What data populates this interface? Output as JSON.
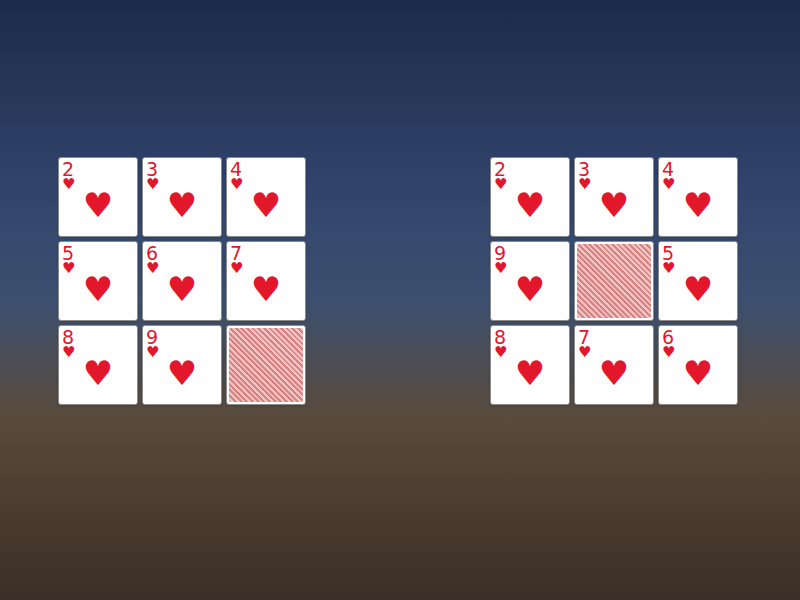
{
  "target": {
    "cards": [
      {
        "kind": "face",
        "rank": "2",
        "suit": "♥"
      },
      {
        "kind": "face",
        "rank": "3",
        "suit": "♥"
      },
      {
        "kind": "face",
        "rank": "4",
        "suit": "♥"
      },
      {
        "kind": "face",
        "rank": "5",
        "suit": "♥"
      },
      {
        "kind": "face",
        "rank": "6",
        "suit": "♥"
      },
      {
        "kind": "face",
        "rank": "7",
        "suit": "♥"
      },
      {
        "kind": "face",
        "rank": "8",
        "suit": "♥"
      },
      {
        "kind": "face",
        "rank": "9",
        "suit": "♥"
      },
      {
        "kind": "back"
      }
    ]
  },
  "board": {
    "cards": [
      {
        "kind": "face",
        "rank": "2",
        "suit": "♥"
      },
      {
        "kind": "face",
        "rank": "3",
        "suit": "♥"
      },
      {
        "kind": "face",
        "rank": "4",
        "suit": "♥"
      },
      {
        "kind": "face",
        "rank": "9",
        "suit": "♥"
      },
      {
        "kind": "back"
      },
      {
        "kind": "face",
        "rank": "5",
        "suit": "♥"
      },
      {
        "kind": "face",
        "rank": "8",
        "suit": "♥"
      },
      {
        "kind": "face",
        "rank": "7",
        "suit": "♥"
      },
      {
        "kind": "face",
        "rank": "6",
        "suit": "♥"
      }
    ]
  }
}
